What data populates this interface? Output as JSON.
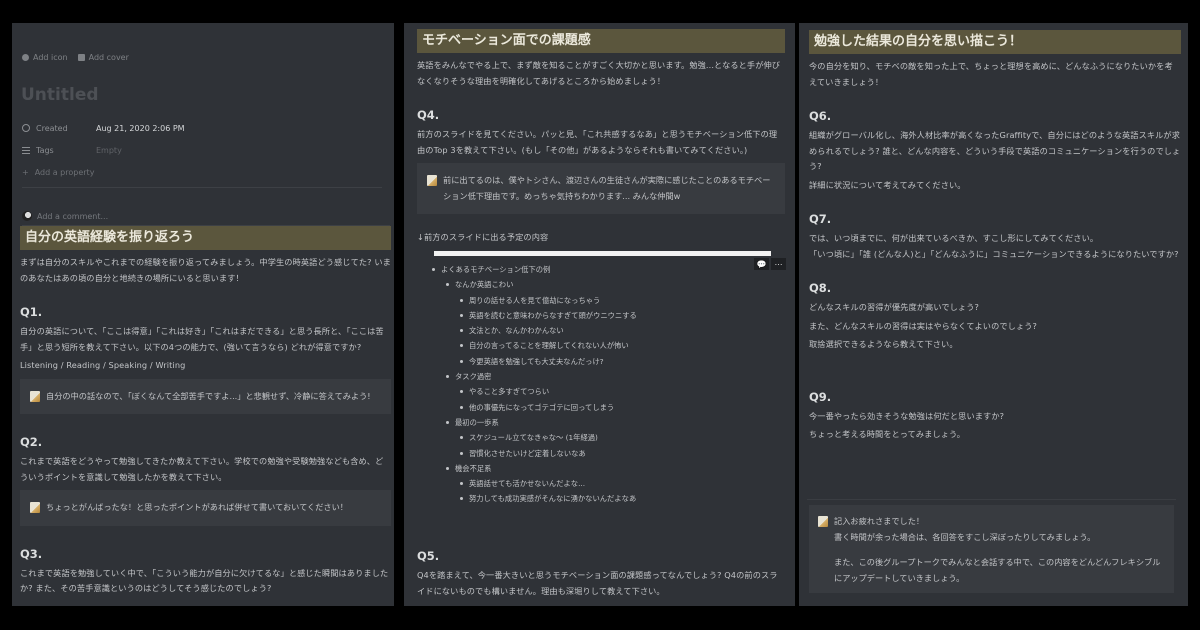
{
  "panel1": {
    "add_icon": "Add icon",
    "add_cover": "Add cover",
    "title": "Untitled",
    "properties": [
      {
        "key": "Created",
        "icon": "clock-icon",
        "value": "Aug 21, 2020 2:06 PM"
      },
      {
        "key": "Tags",
        "icon": "list-icon",
        "value": "Empty"
      }
    ],
    "add_property": "Add a property",
    "add_comment": "Add a comment...",
    "heading": "自分の英語経験を振り返ろう",
    "intro": "まずは自分のスキルやこれまでの経験を振り返ってみましょう。中学生の時英語どう感じてた? いまのあなたはあの頃の自分と地続きの場所にいると思います！",
    "q1": {
      "label": "Q1.",
      "text": "自分の英語について、「ここは得意」「これは好き」「これはまだできる」と思う長所と、「ここは苦手」と思う短所を教えて下さい。以下の4つの能力で、(強いて言うなら) どれが得意ですか?",
      "skills": "Listening / Reading / Speaking / Writing",
      "callout": "自分の中の話なので、「ぼくなんて全部苦手ですよ...」と悲観せず、冷静に答えてみよう!"
    },
    "q2": {
      "label": "Q2.",
      "text": "これまで英語をどうやって勉強してきたか教えて下さい。学校での勉強や受験勉強なども含め、どういうポイントを意識して勉強したかを教えて下さい。",
      "callout": "ちょっとがんばったな！と思ったポイントがあれば併せて書いておいてください！"
    },
    "q3": {
      "label": "Q3.",
      "text": "これまで英語を勉強していく中で、「こういう能力が自分に欠けてるな」と感じた瞬間はありましたか? また、その苦手意識というのはどうしてそう感じたのでしょう?"
    }
  },
  "panel2": {
    "heading": "モチベーション面での課題感",
    "intro": "英語をみんなでやる上で、まず敵を知ることがすごく大切かと思います。勉強...となると手が伸びなくなりそうな理由を明確化してあげるところから始めましょう！",
    "q4": {
      "label": "Q4.",
      "text": "前方のスライドを見てください。パッと見、「これ共感するなあ」と思うモチベーション低下の理由のTop 3を教えて下さい。(もし「その他」があるようならそれも書いてみてください。)",
      "callout": "前に出てるのは、僕やトシさん、渡辺さんの生徒さんが実際に感じたことのあるモチベーション低下理由です。めっちゃ気持ちわかります... みんな仲間w"
    },
    "slide_caption": "↓前方のスライドに出る予定の内容",
    "bullets": [
      {
        "level": 1,
        "text": "よくあるモチベーション低下の例"
      },
      {
        "level": 2,
        "text": "なんか英語こわい"
      },
      {
        "level": 3,
        "text": "周りの話せる人を見て億劫になっちゃう"
      },
      {
        "level": 3,
        "text": "英語を読むと意味わからなすぎて頭がウニウニする"
      },
      {
        "level": 3,
        "text": "文法とか、なんかわかんない"
      },
      {
        "level": 3,
        "text": "自分の言ってることを理解してくれない人が怖い"
      },
      {
        "level": 3,
        "text": "今更英語を勉強しても大丈夫なんだっけ?"
      },
      {
        "level": 2,
        "text": "タスク過密"
      },
      {
        "level": 3,
        "text": "やること多すぎてつらい"
      },
      {
        "level": 3,
        "text": "他の事優先になってゴテゴテに回ってしまう"
      },
      {
        "level": 2,
        "text": "最初の一歩系"
      },
      {
        "level": 3,
        "text": "スケジュール立てなきゃな〜 (1年経過)"
      },
      {
        "level": 3,
        "text": "習慣化させたいけど定着しないなあ"
      },
      {
        "level": 2,
        "text": "機会不足系"
      },
      {
        "level": 3,
        "text": "英語話せても活かせないんだよな..."
      },
      {
        "level": 3,
        "text": "努力しても成功実感がそんなに湧かないんだよなあ"
      }
    ],
    "tools": {
      "comment": "💬",
      "more": "⋯"
    },
    "q5": {
      "label": "Q5.",
      "text": "Q4を踏まえて、今一番大きいと思うモチベーション面の課題感ってなんでしょう? Q4の前のスライドにないものでも構いません。理由も深堀りして教えて下さい。"
    }
  },
  "panel3": {
    "heading": "勉強した結果の自分を思い描こう！",
    "intro": "今の自分を知り、モチベの敵を知った上で、ちょっと理想を高めに、どんなふうになりたいかを考えていきましょう！",
    "q6": {
      "label": "Q6.",
      "text": "組織がグローバル化し、海外人材比率が高くなったGraffityで、自分にはどのような英語スキルが求められるでしょう? 誰と、どんな内容を、どういう手段で英語のコミュニケーションを行うのでしょう?",
      "text2": "詳細に状況について考えてみてください。"
    },
    "q7": {
      "label": "Q7.",
      "text": "では、いつ頃までに、何が出来ているべきか、すこし形にしてみてください。",
      "text2": "「いつ頃に」「誰 (どんな人)と」「どんなふうに」コミュニケーションできるようになりたいですか?"
    },
    "q8": {
      "label": "Q8.",
      "text": "どんなスキルの習得が優先度が高いでしょう?",
      "text2": "また、どんなスキルの習得は実はやらなくてよいのでしょう?",
      "text3": "取捨選択できるようなら教えて下さい。"
    },
    "q9": {
      "label": "Q9.",
      "text": "今一番やったら効きそうな勉強は何だと思いますか?",
      "text2": "ちょっと考える時間をとってみましょう。"
    },
    "callout": {
      "line1": "記入お疲れさまでした！",
      "line2": "書く時間が余った場合は、各回答をすこし深ぼったりしてみましょう。",
      "line3": "また、この後グループトークでみんなと会話する中で、この内容をどんどんフレキシブルにアップデートしていきましょう。"
    }
  }
}
